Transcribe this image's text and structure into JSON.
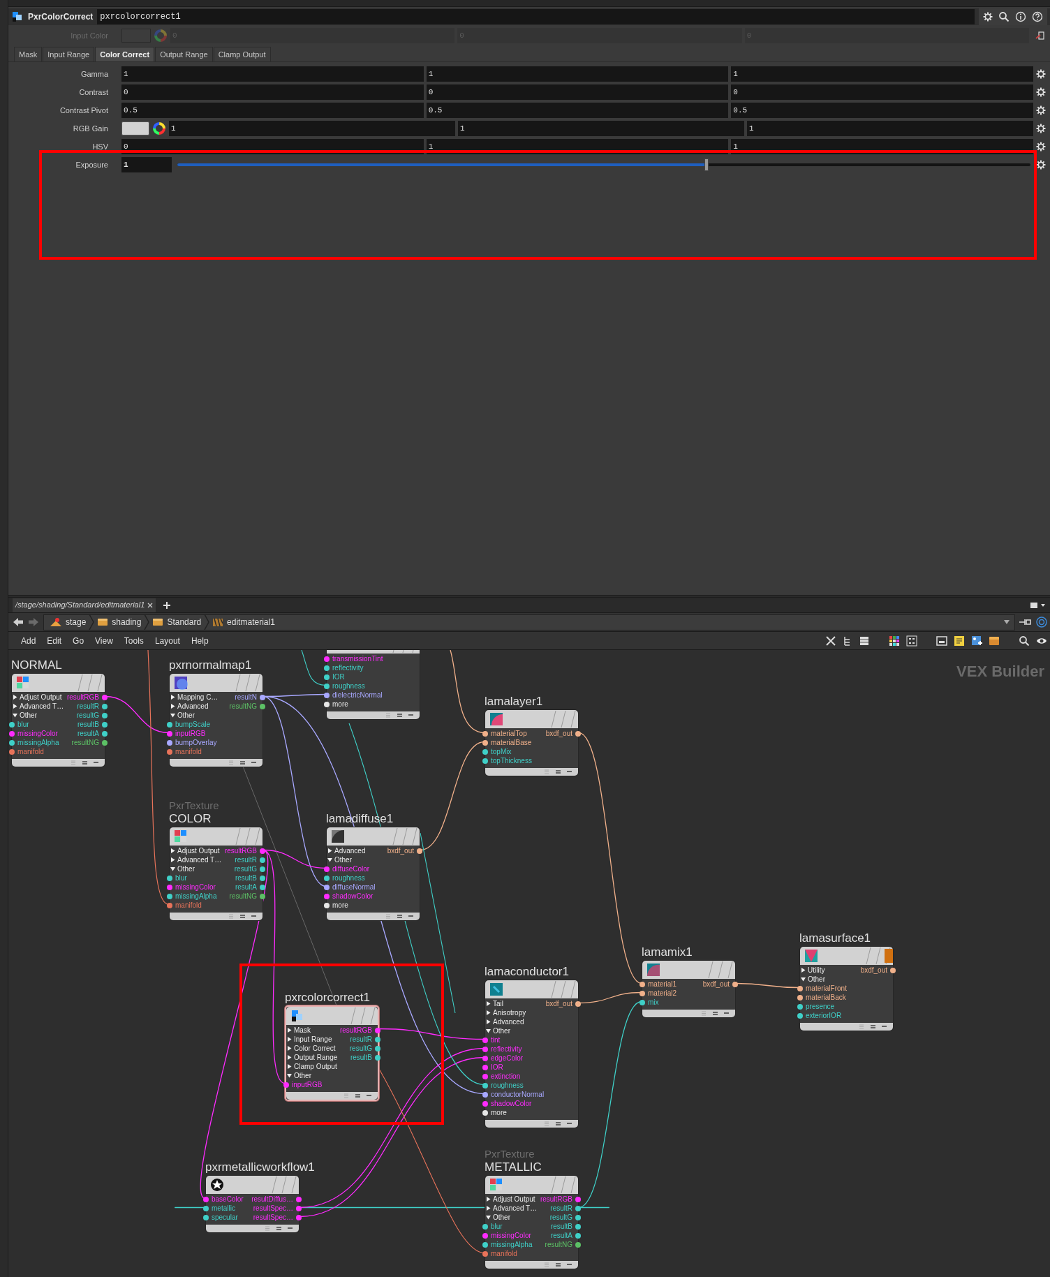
{
  "parameter_pane": {
    "node_type": "PxrColorCorrect",
    "node_name": "pxrcolorcorrect1",
    "input_color": {
      "label": "Input Color",
      "disabled": true,
      "values": [
        "0",
        "0",
        "0"
      ]
    },
    "tabs": [
      {
        "label": "Mask",
        "selected": false
      },
      {
        "label": "Input Range",
        "selected": false
      },
      {
        "label": "Color Correct",
        "selected": true
      },
      {
        "label": "Output Range",
        "selected": false
      },
      {
        "label": "Clamp Output",
        "selected": false
      }
    ],
    "params": [
      {
        "kind": "vector",
        "label": "Gamma",
        "values": [
          "1",
          "1",
          "1"
        ]
      },
      {
        "kind": "vector",
        "label": "Contrast",
        "values": [
          "0",
          "0",
          "0"
        ]
      },
      {
        "kind": "vector",
        "label": "Contrast Pivot",
        "values": [
          "0.5",
          "0.5",
          "0.5"
        ]
      },
      {
        "kind": "color",
        "label": "RGB Gain",
        "values": [
          "1",
          "1",
          "1"
        ]
      },
      {
        "kind": "vector",
        "label": "HSV",
        "values": [
          "0",
          "1",
          "1"
        ]
      },
      {
        "kind": "slider",
        "label": "Exposure",
        "value": "1",
        "level": 0.62
      }
    ]
  },
  "network_pane": {
    "tab": {
      "label": "/stage/shading/Standard/editmaterial1"
    },
    "breadcrumbs": [
      "stage",
      "shading",
      "Standard",
      "editmaterial1"
    ],
    "menu": [
      "Add",
      "Edit",
      "Go",
      "View",
      "Tools",
      "Layout",
      "Help"
    ],
    "context_label": "VEX Builder",
    "nodes": [
      {
        "title": "NORMAL",
        "selected": false,
        "rows": [
          {
            "left": {
              "kind": "folder",
              "label": "Adjust Output",
              "expanded": false
            },
            "right": {
              "label": "resultRGB",
              "color": "#ff2bff"
            }
          },
          {
            "left": {
              "kind": "folder",
              "label": "Advanced T…",
              "expanded": false
            },
            "right": {
              "label": "resultR",
              "color": "#3fd0c8"
            }
          },
          {
            "left": {
              "kind": "folder",
              "label": "Other",
              "expanded": true
            },
            "right": {
              "label": "resultG",
              "color": "#3fd0c8"
            }
          },
          {
            "left": {
              "kind": "port",
              "label": "blur",
              "color": "#3fd0c8"
            },
            "right": {
              "label": "resultB",
              "color": "#3fd0c8"
            }
          },
          {
            "left": {
              "kind": "port",
              "label": "missingColor",
              "color": "#ff2bff"
            },
            "right": {
              "label": "resultA",
              "color": "#3fd0c8"
            }
          },
          {
            "left": {
              "kind": "port",
              "label": "missingAlpha",
              "color": "#3fd0c8"
            },
            "right": {
              "label": "resultNG",
              "color": "#5cc065"
            }
          },
          {
            "left": {
              "kind": "port",
              "label": "manifold",
              "color": "#e8735a"
            }
          }
        ]
      },
      {
        "title": "pxrnormalmap1",
        "selected": false,
        "rows": [
          {
            "left": {
              "kind": "folder",
              "label": "Mapping C…",
              "expanded": false
            },
            "right": {
              "label": "resultN",
              "color": "#a8a8ff"
            }
          },
          {
            "left": {
              "kind": "folder",
              "label": "Advanced",
              "expanded": false
            },
            "right": {
              "label": "resultNG",
              "color": "#5cc065"
            }
          },
          {
            "left": {
              "kind": "folder",
              "label": "Other",
              "expanded": true
            }
          },
          {
            "left": {
              "kind": "port",
              "label": "bumpScale",
              "color": "#3fd0c8"
            }
          },
          {
            "left": {
              "kind": "port",
              "label": "inputRGB",
              "color": "#ff2bff"
            }
          },
          {
            "left": {
              "kind": "port",
              "label": "bumpOverlay",
              "color": "#a8a8ff"
            }
          },
          {
            "left": {
              "kind": "port",
              "label": "manifold",
              "color": "#e8735a"
            }
          }
        ]
      },
      {
        "selected": false,
        "rows": [
          {
            "left": {
              "kind": "port",
              "label": "transmissionTint",
              "color": "#ff2bff"
            }
          },
          {
            "left": {
              "kind": "port",
              "label": "reflectivity",
              "color": "#3fd0c8"
            }
          },
          {
            "left": {
              "kind": "port",
              "label": "IOR",
              "color": "#3fd0c8"
            }
          },
          {
            "left": {
              "kind": "port",
              "label": "roughness",
              "color": "#3fd0c8"
            }
          },
          {
            "left": {
              "kind": "port",
              "label": "dielectricNormal",
              "color": "#a8a8ff"
            }
          },
          {
            "left": {
              "kind": "port",
              "label": "more",
              "color": "#e6e6e6"
            }
          }
        ]
      },
      {
        "title": "lamalayer1",
        "selected": false,
        "rows": [
          {
            "left": {
              "kind": "port",
              "label": "materialTop",
              "color": "#f0b08a"
            },
            "right": {
              "label": "bxdf_out",
              "color": "#f0b08a"
            }
          },
          {
            "left": {
              "kind": "port",
              "label": "materialBase",
              "color": "#f0b08a"
            }
          },
          {
            "left": {
              "kind": "port",
              "label": "topMix",
              "color": "#3fd0c8"
            }
          },
          {
            "left": {
              "kind": "port",
              "label": "topThickness",
              "color": "#3fd0c8"
            }
          }
        ]
      },
      {
        "subtitle": "PxrTexture",
        "title": "COLOR",
        "selected": false,
        "rows": [
          {
            "left": {
              "kind": "folder",
              "label": "Adjust Output",
              "expanded": false
            },
            "right": {
              "label": "resultRGB",
              "color": "#ff2bff"
            }
          },
          {
            "left": {
              "kind": "folder",
              "label": "Advanced T…",
              "expanded": false
            },
            "right": {
              "label": "resultR",
              "color": "#3fd0c8"
            }
          },
          {
            "left": {
              "kind": "folder",
              "label": "Other",
              "expanded": true
            },
            "right": {
              "label": "resultG",
              "color": "#3fd0c8"
            }
          },
          {
            "left": {
              "kind": "port",
              "label": "blur",
              "color": "#3fd0c8"
            },
            "right": {
              "label": "resultB",
              "color": "#3fd0c8"
            }
          },
          {
            "left": {
              "kind": "port",
              "label": "missingColor",
              "color": "#ff2bff"
            },
            "right": {
              "label": "resultA",
              "color": "#3fd0c8"
            }
          },
          {
            "left": {
              "kind": "port",
              "label": "missingAlpha",
              "color": "#3fd0c8"
            },
            "right": {
              "label": "resultNG",
              "color": "#5cc065"
            }
          },
          {
            "left": {
              "kind": "port",
              "label": "manifold",
              "color": "#e8735a"
            }
          }
        ]
      },
      {
        "title": "lamadiffuse1",
        "selected": false,
        "rows": [
          {
            "left": {
              "kind": "folder",
              "label": "Advanced",
              "expanded": false
            },
            "right": {
              "label": "bxdf_out",
              "color": "#f0b08a"
            }
          },
          {
            "left": {
              "kind": "folder",
              "label": "Other",
              "expanded": true
            }
          },
          {
            "left": {
              "kind": "port",
              "label": "diffuseColor",
              "color": "#ff2bff"
            }
          },
          {
            "left": {
              "kind": "port",
              "label": "roughness",
              "color": "#3fd0c8"
            }
          },
          {
            "left": {
              "kind": "port",
              "label": "diffuseNormal",
              "color": "#a8a8ff"
            }
          },
          {
            "left": {
              "kind": "port",
              "label": "shadowColor",
              "color": "#ff2bff"
            }
          },
          {
            "left": {
              "kind": "port",
              "label": "more",
              "color": "#e6e6e6"
            }
          }
        ]
      },
      {
        "title": "pxrcolorcorrect1",
        "selected": true,
        "rows": [
          {
            "left": {
              "kind": "folder",
              "label": "Mask",
              "expanded": false
            },
            "right": {
              "label": "resultRGB",
              "color": "#ff2bff"
            }
          },
          {
            "left": {
              "kind": "folder",
              "label": "Input Range",
              "expanded": false
            },
            "right": {
              "label": "resultR",
              "color": "#3fd0c8"
            }
          },
          {
            "left": {
              "kind": "folder",
              "label": "Color Correct",
              "expanded": false
            },
            "right": {
              "label": "resultG",
              "color": "#3fd0c8"
            }
          },
          {
            "left": {
              "kind": "folder",
              "label": "Output Range",
              "expanded": false
            },
            "right": {
              "label": "resultB",
              "color": "#3fd0c8"
            }
          },
          {
            "left": {
              "kind": "folder",
              "label": "Clamp Output",
              "expanded": false
            }
          },
          {
            "left": {
              "kind": "folder",
              "label": "Other",
              "expanded": true
            }
          },
          {
            "left": {
              "kind": "port",
              "label": "inputRGB",
              "color": "#ff2bff"
            }
          }
        ]
      },
      {
        "title": "lamaconductor1",
        "selected": false,
        "rows": [
          {
            "left": {
              "kind": "folder",
              "label": "Tail",
              "expanded": false
            },
            "right": {
              "label": "bxdf_out",
              "color": "#f0b08a"
            }
          },
          {
            "left": {
              "kind": "folder",
              "label": "Anisotropy",
              "expanded": false
            }
          },
          {
            "left": {
              "kind": "folder",
              "label": "Advanced",
              "expanded": false
            }
          },
          {
            "left": {
              "kind": "folder",
              "label": "Other",
              "expanded": true
            }
          },
          {
            "left": {
              "kind": "port",
              "label": "tint",
              "color": "#ff2bff"
            }
          },
          {
            "left": {
              "kind": "port",
              "label": "reflectivity",
              "color": "#ff2bff"
            }
          },
          {
            "left": {
              "kind": "port",
              "label": "edgeColor",
              "color": "#ff2bff"
            }
          },
          {
            "left": {
              "kind": "port",
              "label": "IOR",
              "color": "#ff2bff"
            }
          },
          {
            "left": {
              "kind": "port",
              "label": "extinction",
              "color": "#ff2bff"
            }
          },
          {
            "left": {
              "kind": "port",
              "label": "roughness",
              "color": "#3fd0c8"
            }
          },
          {
            "left": {
              "kind": "port",
              "label": "conductorNormal",
              "color": "#a8a8ff"
            }
          },
          {
            "left": {
              "kind": "port",
              "label": "shadowColor",
              "color": "#ff2bff"
            }
          },
          {
            "left": {
              "kind": "port",
              "label": "more",
              "color": "#e6e6e6"
            }
          }
        ]
      },
      {
        "title": "lamamix1",
        "selected": false,
        "rows": [
          {
            "left": {
              "kind": "port",
              "label": "material1",
              "color": "#f0b08a"
            },
            "right": {
              "label": "bxdf_out",
              "color": "#f0b08a"
            }
          },
          {
            "left": {
              "kind": "port",
              "label": "material2",
              "color": "#f0b08a"
            }
          },
          {
            "left": {
              "kind": "port",
              "label": "mix",
              "color": "#3fd0c8"
            }
          }
        ]
      },
      {
        "title": "lamasurface1",
        "selected": false,
        "rows": [
          {
            "left": {
              "kind": "folder",
              "label": "Utility",
              "expanded": false
            },
            "right": {
              "label": "bxdf_out",
              "color": "#f0b08a"
            }
          },
          {
            "left": {
              "kind": "folder",
              "label": "Other",
              "expanded": true
            }
          },
          {
            "left": {
              "kind": "port",
              "label": "materialFront",
              "color": "#f0b08a"
            }
          },
          {
            "left": {
              "kind": "port",
              "label": "materialBack",
              "color": "#f0b08a"
            }
          },
          {
            "left": {
              "kind": "port",
              "label": "presence",
              "color": "#3fd0c8"
            }
          },
          {
            "left": {
              "kind": "port",
              "label": "exteriorIOR",
              "color": "#3fd0c8"
            }
          }
        ]
      },
      {
        "title": "pxrmetallicworkflow1",
        "selected": false,
        "rows": [
          {
            "left": {
              "kind": "port",
              "label": "baseColor",
              "color": "#ff2bff"
            },
            "right": {
              "label": "resultDiffus…",
              "color": "#ff2bff"
            }
          },
          {
            "left": {
              "kind": "port",
              "label": "metallic",
              "color": "#3fd0c8"
            },
            "right": {
              "label": "resultSpec…",
              "color": "#ff2bff"
            }
          },
          {
            "left": {
              "kind": "port",
              "label": "specular",
              "color": "#3fd0c8"
            },
            "right": {
              "label": "resultSpec…",
              "color": "#ff2bff"
            }
          }
        ]
      },
      {
        "subtitle": "PxrTexture",
        "title": "METALLIC",
        "selected": false,
        "rows": [
          {
            "left": {
              "kind": "folder",
              "label": "Adjust Output",
              "expanded": false
            },
            "right": {
              "label": "resultRGB",
              "color": "#ff2bff"
            }
          },
          {
            "left": {
              "kind": "folder",
              "label": "Advanced T…",
              "expanded": false
            },
            "right": {
              "label": "resultR",
              "color": "#3fd0c8"
            }
          },
          {
            "left": {
              "kind": "folder",
              "label": "Other",
              "expanded": true
            },
            "right": {
              "label": "resultG",
              "color": "#3fd0c8"
            }
          },
          {
            "left": {
              "kind": "port",
              "label": "blur",
              "color": "#3fd0c8"
            },
            "right": {
              "label": "resultB",
              "color": "#3fd0c8"
            }
          },
          {
            "left": {
              "kind": "port",
              "label": "missingColor",
              "color": "#ff2bff"
            },
            "right": {
              "label": "resultA",
              "color": "#3fd0c8"
            }
          },
          {
            "left": {
              "kind": "port",
              "label": "missingAlpha",
              "color": "#3fd0c8"
            },
            "right": {
              "label": "resultNG",
              "color": "#5cc065"
            }
          },
          {
            "left": {
              "kind": "port",
              "label": "manifold",
              "color": "#e8735a"
            }
          }
        ]
      }
    ]
  }
}
